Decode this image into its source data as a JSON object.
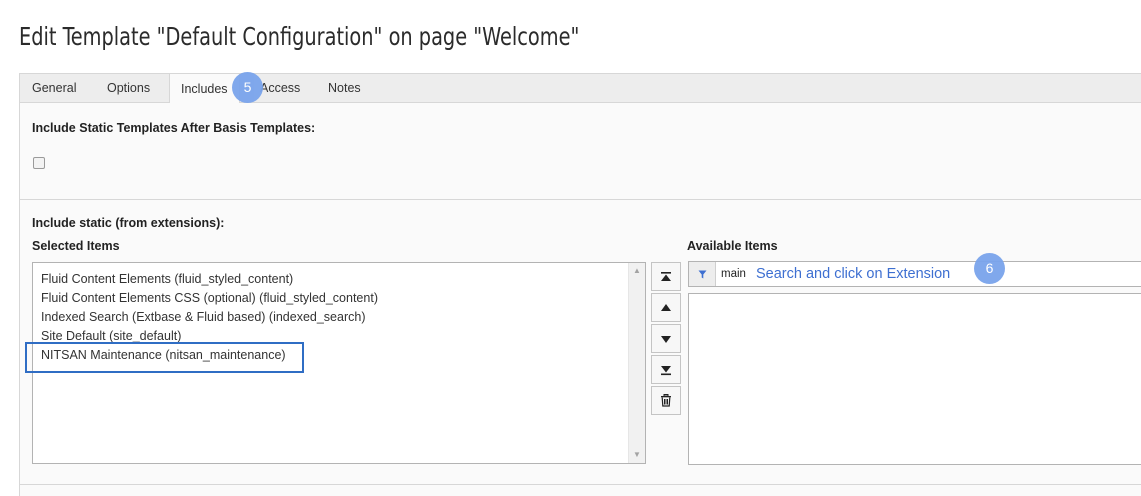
{
  "page": {
    "title": "Edit Template \"Default Configuration\" on page \"Welcome\""
  },
  "tabs": [
    {
      "label": "General"
    },
    {
      "label": "Options"
    },
    {
      "label": "Includes",
      "active": true
    },
    {
      "label": "Access"
    },
    {
      "label": "Notes"
    }
  ],
  "static_section": {
    "label": "Include Static Templates After Basis Templates:",
    "checked": false
  },
  "extensions_section": {
    "label": "Include static (from extensions):",
    "selected_label": "Selected Items",
    "available_label": "Available Items",
    "selected_items": [
      "Fluid Content Elements (fluid_styled_content)",
      "Fluid Content Elements CSS (optional) (fluid_styled_content)",
      "Indexed Search (Extbase & Fluid based) (indexed_search)",
      "Site Default (site_default)",
      "NITSAN Maintenance (nitsan_maintenance)"
    ],
    "filter_value": "main",
    "available_items": []
  },
  "annotations": {
    "badge_tab": "5",
    "badge_filter": "6",
    "filter_hint": "Search and click on Extension"
  },
  "colors": {
    "accent": "#2f6dc4",
    "badge": "#7aa4ec",
    "hint": "#3d6fd1"
  },
  "icons": {
    "move_top": "move-to-top-icon",
    "move_up": "move-up-icon",
    "move_down": "move-down-icon",
    "move_bottom": "move-to-bottom-icon",
    "remove": "trash-icon",
    "filter": "filter-icon"
  }
}
